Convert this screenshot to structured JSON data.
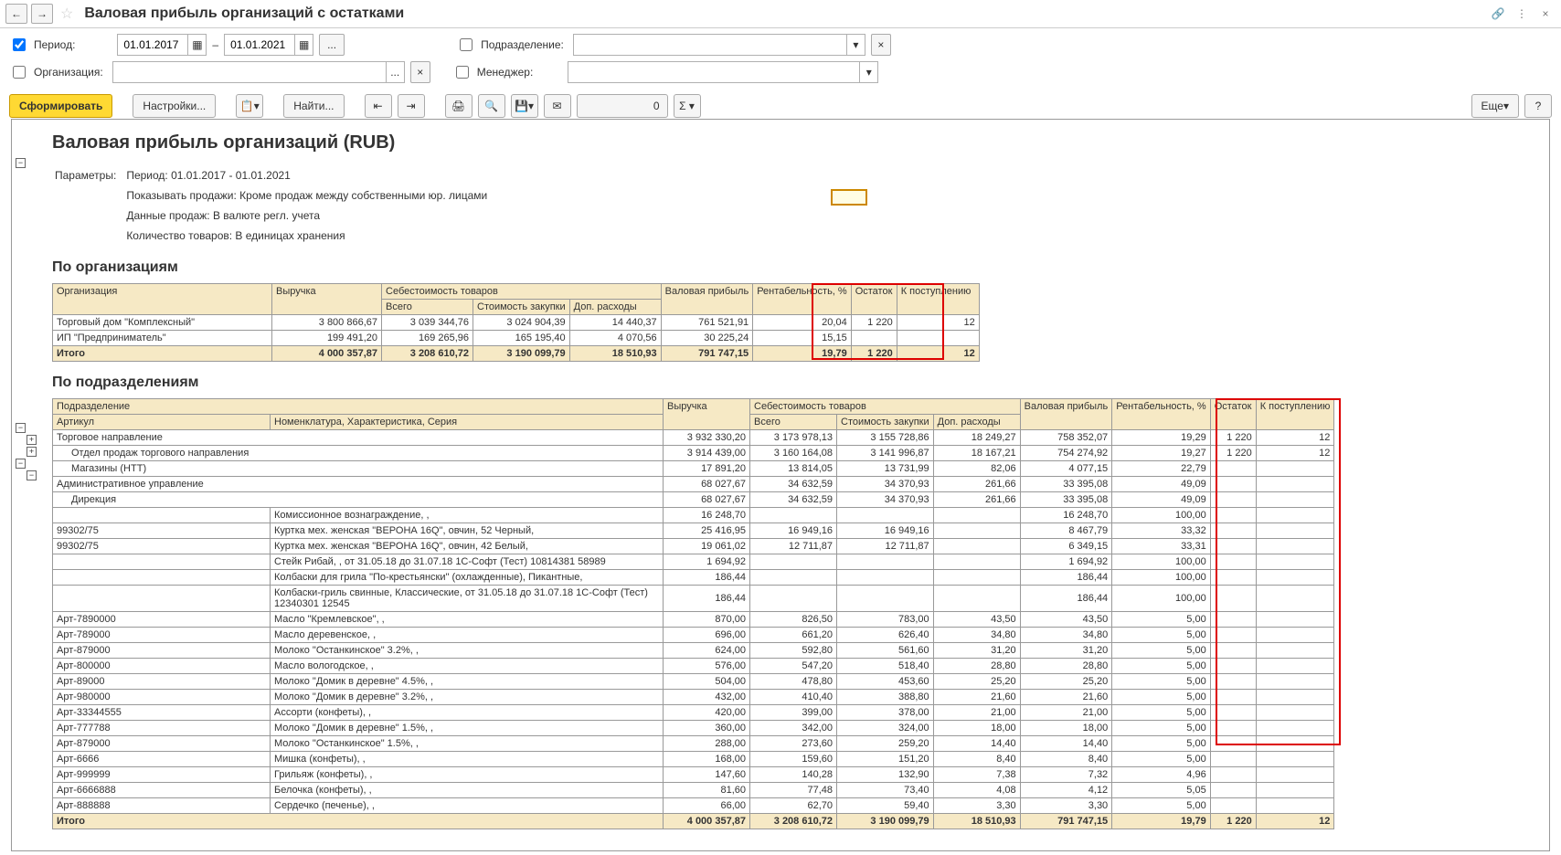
{
  "title": "Валовая прибыль организаций с остатками",
  "filters": {
    "period_label": "Период:",
    "date_from": "01.01.2017",
    "date_to": "01.01.2021",
    "dash": "–",
    "org_label": "Организация:",
    "podrazd_label": "Подразделение:",
    "manager_label": "Менеджер:"
  },
  "tb": {
    "form": "Сформировать",
    "settings": "Настройки...",
    "find": "Найти...",
    "num": "0",
    "more": "Еще",
    "help": "?"
  },
  "report": {
    "heading": "Валовая прибыль организаций (RUB)",
    "params_label": "Параметры:",
    "p1": "Период: 01.01.2017 - 01.01.2021",
    "p2": "Показывать продажи: Кроме продаж между собственными юр. лицами",
    "p3": "Данные продаж: В валюте регл. учета",
    "p4": "Количество товаров: В единицах хранения",
    "sec1": "По организациям",
    "sec2": "По подразделениям"
  },
  "h": {
    "org": "Организация",
    "vyr": "Выручка",
    "seb": "Себестоимость товаров",
    "vsego": "Всего",
    "stoim": "Стоимость закупки",
    "dop": "Доп. расходы",
    "val": "Валовая прибыль",
    "rent": "Рентабельность, %",
    "ost": "Остаток",
    "kpost": "К поступлению",
    "podrazd": "Подразделение",
    "artikul": "Артикул",
    "nomen": "Номенклатура, Характеристика, Серия"
  },
  "org_rows": [
    {
      "name": "Торговый дом \"Комплексный\"",
      "vyr": "3 800 866,67",
      "vs": "3 039 344,76",
      "st": "3 024 904,39",
      "dop": "14 440,37",
      "val": "761 521,91",
      "rent": "20,04",
      "ost": "1 220",
      "kp": "12"
    },
    {
      "name": "ИП \"Предприниматель\"",
      "vyr": "199 491,20",
      "vs": "169 265,96",
      "st": "165 195,40",
      "dop": "4 070,56",
      "val": "30 225,24",
      "rent": "15,15",
      "ost": "",
      "kp": ""
    }
  ],
  "org_total": {
    "name": "Итого",
    "vyr": "4 000 357,87",
    "vs": "3 208 610,72",
    "st": "3 190 099,79",
    "dop": "18 510,93",
    "val": "791 747,15",
    "rent": "19,79",
    "ost": "1 220",
    "kp": "12"
  },
  "pod_rows": [
    {
      "ind": 0,
      "art": "Торговое направление",
      "nom": "",
      "vyr": "3 932 330,20",
      "vs": "3 173 978,13",
      "st": "3 155 728,86",
      "dop": "18 249,27",
      "val": "758 352,07",
      "rent": "19,29",
      "ost": "1 220",
      "kp": "12"
    },
    {
      "ind": 1,
      "art": "Отдел продаж торгового направления",
      "nom": "",
      "vyr": "3 914 439,00",
      "vs": "3 160 164,08",
      "st": "3 141 996,87",
      "dop": "18 167,21",
      "val": "754 274,92",
      "rent": "19,27",
      "ost": "1 220",
      "kp": "12"
    },
    {
      "ind": 1,
      "art": "Магазины (НТТ)",
      "nom": "",
      "vyr": "17 891,20",
      "vs": "13 814,05",
      "st": "13 731,99",
      "dop": "82,06",
      "val": "4 077,15",
      "rent": "22,79",
      "ost": "",
      "kp": ""
    },
    {
      "ind": 0,
      "art": "Административное управление",
      "nom": "",
      "vyr": "68 027,67",
      "vs": "34 632,59",
      "st": "34 370,93",
      "dop": "261,66",
      "val": "33 395,08",
      "rent": "49,09",
      "ost": "",
      "kp": ""
    },
    {
      "ind": 1,
      "art": "Дирекция",
      "nom": "",
      "vyr": "68 027,67",
      "vs": "34 632,59",
      "st": "34 370,93",
      "dop": "261,66",
      "val": "33 395,08",
      "rent": "49,09",
      "ost": "",
      "kp": ""
    },
    {
      "ind": 0,
      "art": "",
      "nom": "Комиссионное вознаграждение, ,",
      "vyr": "16 248,70",
      "vs": "",
      "st": "",
      "dop": "",
      "val": "16 248,70",
      "rent": "100,00",
      "ost": "",
      "kp": ""
    },
    {
      "ind": 0,
      "art": "99302/75",
      "nom": "Куртка мех. женская \"ВЕРОНА 16Q\", овчин, 52 Черный,",
      "vyr": "25 416,95",
      "vs": "16 949,16",
      "st": "16 949,16",
      "dop": "",
      "val": "8 467,79",
      "rent": "33,32",
      "ost": "",
      "kp": ""
    },
    {
      "ind": 0,
      "art": "99302/75",
      "nom": "Куртка мех. женская \"ВЕРОНА 16Q\", овчин, 42 Белый,",
      "vyr": "19 061,02",
      "vs": "12 711,87",
      "st": "12 711,87",
      "dop": "",
      "val": "6 349,15",
      "rent": "33,31",
      "ost": "",
      "kp": ""
    },
    {
      "ind": 0,
      "art": "",
      "nom": "Стейк Рибай, , от 31.05.18 до 31.07.18 1С-Софт (Тест) 10814381 58989",
      "vyr": "1 694,92",
      "vs": "",
      "st": "",
      "dop": "",
      "val": "1 694,92",
      "rent": "100,00",
      "ost": "",
      "kp": ""
    },
    {
      "ind": 0,
      "art": "",
      "nom": "Колбаски для грила \"По-крестьянски\" (охлажденные), Пикантные,",
      "vyr": "186,44",
      "vs": "",
      "st": "",
      "dop": "",
      "val": "186,44",
      "rent": "100,00",
      "ost": "",
      "kp": ""
    },
    {
      "ind": 0,
      "art": "",
      "nom": "Колбаски-гриль свинные, Классические, от 31.05.18 до 31.07.18 1С-Софт (Тест) 12340301 12545",
      "vyr": "186,44",
      "vs": "",
      "st": "",
      "dop": "",
      "val": "186,44",
      "rent": "100,00",
      "ost": "",
      "kp": ""
    },
    {
      "ind": 0,
      "art": "Арт-7890000",
      "nom": "Масло \"Кремлевское\", ,",
      "vyr": "870,00",
      "vs": "826,50",
      "st": "783,00",
      "dop": "43,50",
      "val": "43,50",
      "rent": "5,00",
      "ost": "",
      "kp": ""
    },
    {
      "ind": 0,
      "art": "Арт-789000",
      "nom": "Масло деревенское, ,",
      "vyr": "696,00",
      "vs": "661,20",
      "st": "626,40",
      "dop": "34,80",
      "val": "34,80",
      "rent": "5,00",
      "ost": "",
      "kp": ""
    },
    {
      "ind": 0,
      "art": "Арт-879000",
      "nom": "Молоко \"Останкинское\" 3.2%, ,",
      "vyr": "624,00",
      "vs": "592,80",
      "st": "561,60",
      "dop": "31,20",
      "val": "31,20",
      "rent": "5,00",
      "ost": "",
      "kp": ""
    },
    {
      "ind": 0,
      "art": "Арт-800000",
      "nom": "Масло вологодское, ,",
      "vyr": "576,00",
      "vs": "547,20",
      "st": "518,40",
      "dop": "28,80",
      "val": "28,80",
      "rent": "5,00",
      "ost": "",
      "kp": ""
    },
    {
      "ind": 0,
      "art": "Арт-89000",
      "nom": "Молоко \"Домик в деревне\" 4.5%, ,",
      "vyr": "504,00",
      "vs": "478,80",
      "st": "453,60",
      "dop": "25,20",
      "val": "25,20",
      "rent": "5,00",
      "ost": "",
      "kp": ""
    },
    {
      "ind": 0,
      "art": "Арт-980000",
      "nom": "Молоко \"Домик в деревне\" 3.2%, ,",
      "vyr": "432,00",
      "vs": "410,40",
      "st": "388,80",
      "dop": "21,60",
      "val": "21,60",
      "rent": "5,00",
      "ost": "",
      "kp": ""
    },
    {
      "ind": 0,
      "art": "Арт-33344555",
      "nom": "Ассорти (конфеты), ,",
      "vyr": "420,00",
      "vs": "399,00",
      "st": "378,00",
      "dop": "21,00",
      "val": "21,00",
      "rent": "5,00",
      "ost": "",
      "kp": ""
    },
    {
      "ind": 0,
      "art": "Арт-777788",
      "nom": "Молоко \"Домик в деревне\" 1.5%, ,",
      "vyr": "360,00",
      "vs": "342,00",
      "st": "324,00",
      "dop": "18,00",
      "val": "18,00",
      "rent": "5,00",
      "ost": "",
      "kp": ""
    },
    {
      "ind": 0,
      "art": "Арт-879000",
      "nom": "Молоко \"Останкинское\" 1.5%, ,",
      "vyr": "288,00",
      "vs": "273,60",
      "st": "259,20",
      "dop": "14,40",
      "val": "14,40",
      "rent": "5,00",
      "ost": "",
      "kp": ""
    },
    {
      "ind": 0,
      "art": "Арт-6666",
      "nom": "Мишка (конфеты), ,",
      "vyr": "168,00",
      "vs": "159,60",
      "st": "151,20",
      "dop": "8,40",
      "val": "8,40",
      "rent": "5,00",
      "ost": "",
      "kp": ""
    },
    {
      "ind": 0,
      "art": "Арт-999999",
      "nom": "Грильяж (конфеты), ,",
      "vyr": "147,60",
      "vs": "140,28",
      "st": "132,90",
      "dop": "7,38",
      "val": "7,32",
      "rent": "4,96",
      "ost": "",
      "kp": ""
    },
    {
      "ind": 0,
      "art": "Арт-6666888",
      "nom": "Белочка (конфеты), ,",
      "vyr": "81,60",
      "vs": "77,48",
      "st": "73,40",
      "dop": "4,08",
      "val": "4,12",
      "rent": "5,05",
      "ost": "",
      "kp": ""
    },
    {
      "ind": 0,
      "art": "Арт-888888",
      "nom": "Сердечко (печенье), ,",
      "vyr": "66,00",
      "vs": "62,70",
      "st": "59,40",
      "dop": "3,30",
      "val": "3,30",
      "rent": "5,00",
      "ost": "",
      "kp": ""
    }
  ],
  "pod_total": {
    "name": "Итого",
    "vyr": "4 000 357,87",
    "vs": "3 208 610,72",
    "st": "3 190 099,79",
    "dop": "18 510,93",
    "val": "791 747,15",
    "rent": "19,79",
    "ost": "1 220",
    "kp": "12"
  }
}
